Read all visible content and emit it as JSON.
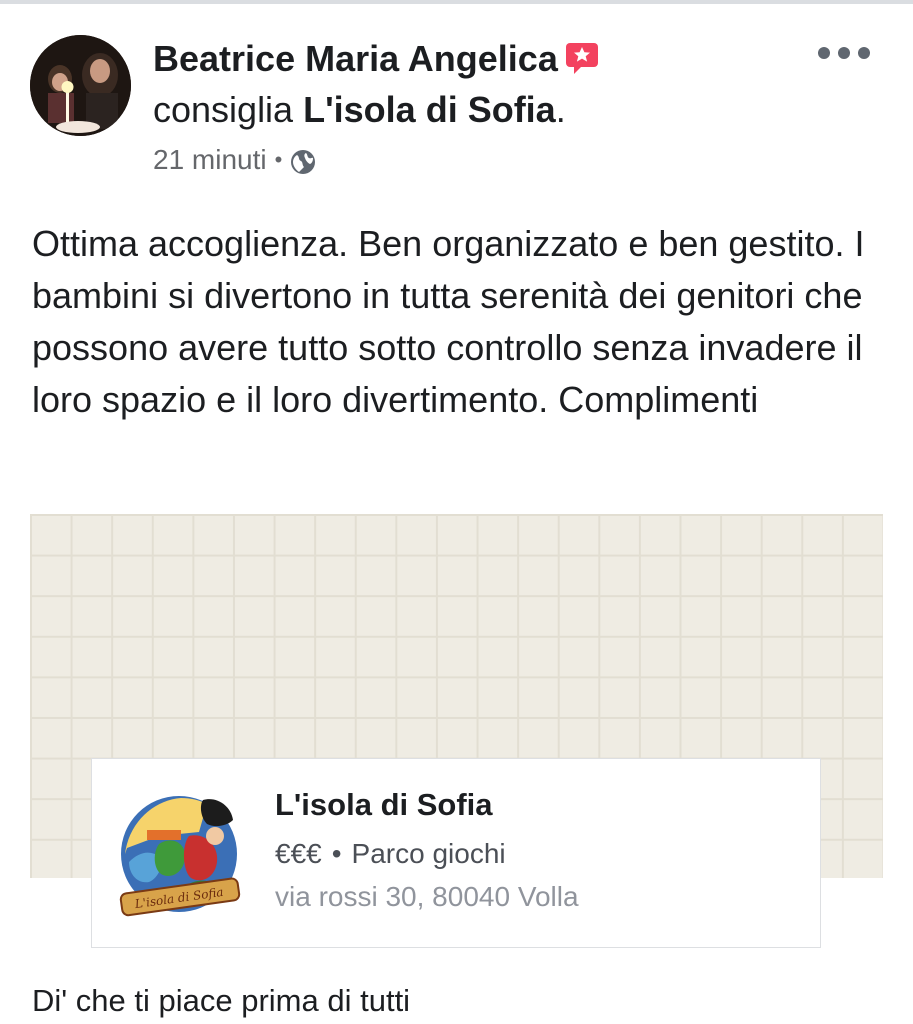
{
  "post": {
    "author": "Beatrice Maria Angelica",
    "action_text": "consiglia",
    "page_name": "L'isola di Sofia",
    "page_name_suffix": ".",
    "time": "21 minuti",
    "meta_separator": "•",
    "privacy_icon": "globe-icon",
    "recommend_icon": "recommendation-star-icon",
    "more_icon": "more-options-icon",
    "body": "Ottima accoglienza. Ben organizzato e ben gestito. I bambini si divertono in tutta serenità dei genitori che possono avere tutto sotto controllo senza invadere il loro spazio e il loro divertimento. Complimenti"
  },
  "place_card": {
    "title": "L'isola di Sofia",
    "price": "€€€",
    "separator": "•",
    "category": "Parco giochi",
    "address": "via rossi 30, 80040 Volla",
    "logo_text": "L'isola di Sofia"
  },
  "footer": {
    "like_prompt": "Di' che ti piace prima di tutti"
  },
  "colors": {
    "text": "#1c1e21",
    "secondary_text": "#65676b",
    "badge": "#f3425f",
    "map_bg": "#efece3",
    "map_grid": "#e2ded2"
  }
}
